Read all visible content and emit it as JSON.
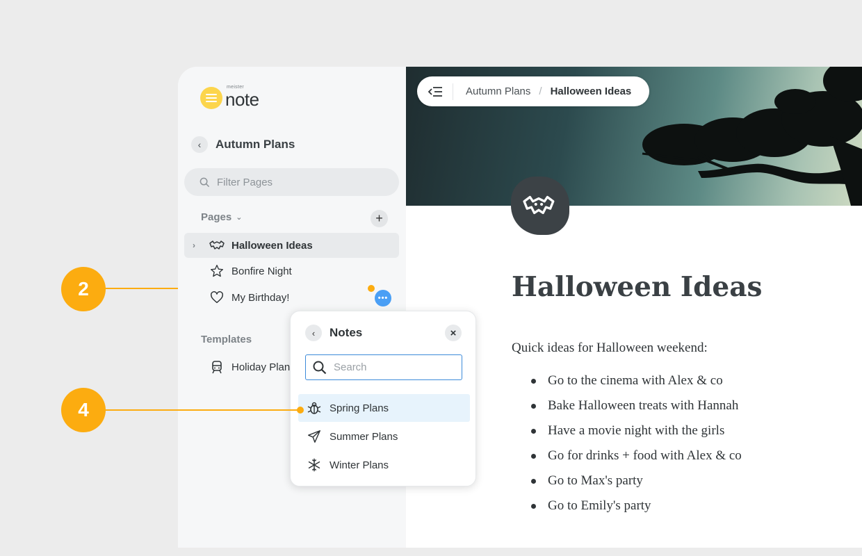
{
  "app": {
    "logo_small": "meister",
    "logo_big": "note"
  },
  "sidebar": {
    "back_title": "Autumn Plans",
    "filter_placeholder": "Filter Pages",
    "pages_heading": "Pages",
    "pages": [
      {
        "label": "Halloween Ideas",
        "icon": "bat-icon",
        "active": true
      },
      {
        "label": "Bonfire Night",
        "icon": "star-icon"
      },
      {
        "label": "My Birthday!",
        "icon": "heart-icon"
      }
    ],
    "templates_heading": "Templates",
    "templates": [
      {
        "label": "Holiday Plan",
        "icon": "train-icon"
      }
    ],
    "more_button": "•••"
  },
  "breadcrumb": {
    "parent": "Autumn Plans",
    "separator": "/",
    "current": "Halloween Ideas"
  },
  "page": {
    "title": "Halloween Ideas",
    "intro": "Quick ideas for Halloween weekend:",
    "bullets": [
      "Go to the cinema with Alex & co",
      "Bake Halloween treats with Hannah",
      "Have a movie night with the girls",
      "Go for drinks + food with Alex & co",
      "Go to Max's party",
      "Go to Emily's party"
    ]
  },
  "popup": {
    "title": "Notes",
    "search_placeholder": "Search",
    "items": [
      {
        "label": "Spring Plans",
        "icon": "bug-icon",
        "highlighted": true
      },
      {
        "label": "Summer Plans",
        "icon": "airplane-icon"
      },
      {
        "label": "Winter Plans",
        "icon": "snowflake-icon"
      }
    ]
  },
  "callouts": [
    "2",
    "4"
  ],
  "colors": {
    "accent": "#fcac10",
    "logo": "#fcd54c",
    "link": "#4a9ff5"
  }
}
